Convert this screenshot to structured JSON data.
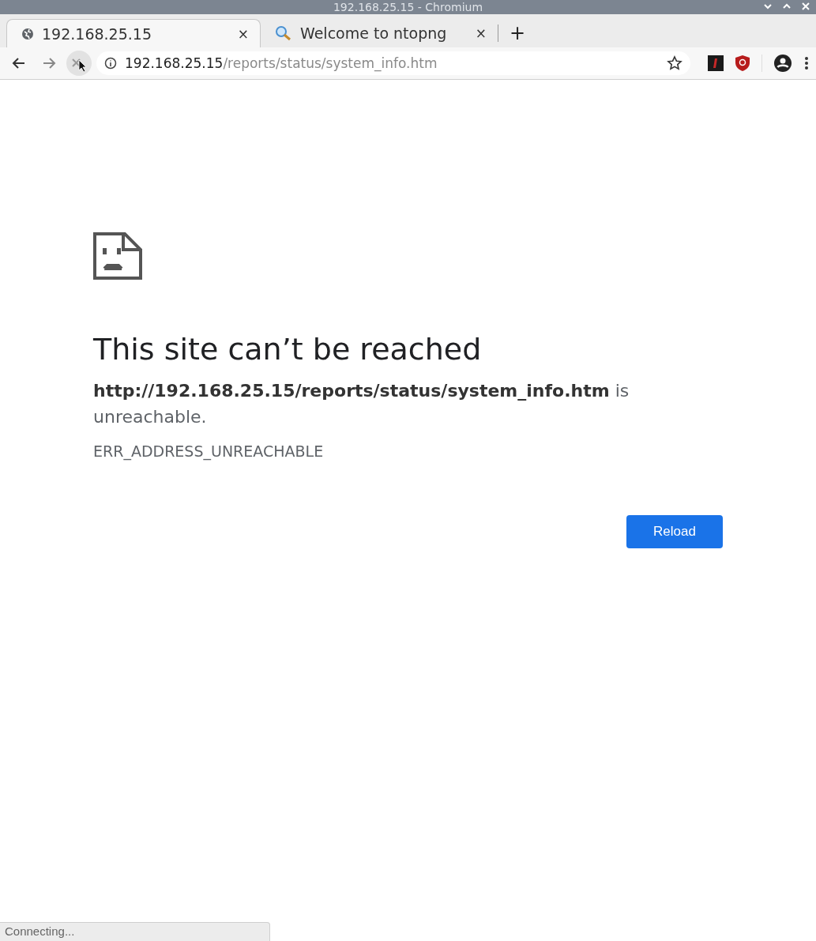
{
  "window": {
    "title": "192.168.25.15 - Chromium"
  },
  "tabs": [
    {
      "title": "192.168.25.15",
      "kind": "globe",
      "selected": true,
      "close": "×"
    },
    {
      "title": "Welcome to ntopng",
      "kind": "search",
      "selected": false,
      "close": "×"
    }
  ],
  "new_tab": "+",
  "url": {
    "host": "192.168.25.15",
    "path": "/reports/status/system_info.htm"
  },
  "error": {
    "heading": "This site can’t be reached",
    "message": "**http://192.168.25.15/reports/status/system_info.htm** is unreachable.",
    "code": "ERR_ADDRESS_UNREACHABLE",
    "button": "Reload"
  },
  "status_bar": "Connecting..."
}
